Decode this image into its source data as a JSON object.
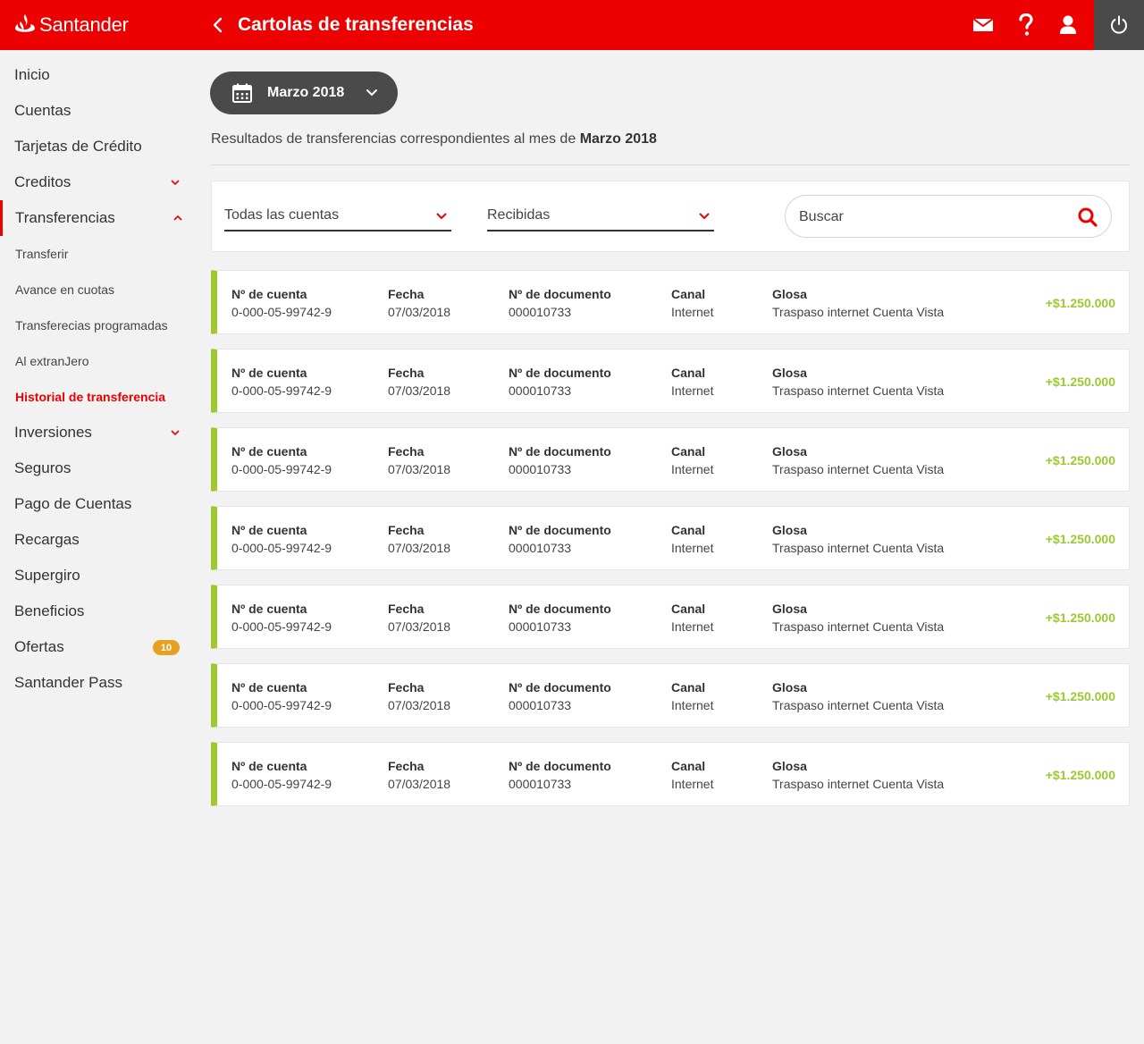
{
  "header": {
    "brand": "Santander",
    "title": "Cartolas de transferencias",
    "icons": [
      "back-arrow-icon",
      "mail-icon",
      "help-icon",
      "user-icon",
      "power-icon"
    ],
    "colors": {
      "brand_red": "#ec0000",
      "dark": "#4a4a4a",
      "positive": "#9bc92e",
      "badge": "#e8a020"
    }
  },
  "sidebar": {
    "items": [
      {
        "label": "Inicio"
      },
      {
        "label": "Cuentas"
      },
      {
        "label": "Tarjetas de Crédito"
      },
      {
        "label": "Creditos",
        "expandable": true
      },
      {
        "label": "Transferencias",
        "expanded": true
      },
      {
        "label": "Transferir"
      },
      {
        "label": "Avance en cuotas"
      },
      {
        "label": "Transferecias programadas"
      },
      {
        "label": "Al extranJero"
      },
      {
        "label": "Historial de transferencia",
        "active": true
      },
      {
        "label": "Inversiones",
        "expandable": true
      },
      {
        "label": "Seguros"
      },
      {
        "label": "Pago de Cuentas"
      },
      {
        "label": "Recargas"
      },
      {
        "label": "Supergiro"
      },
      {
        "label": "Beneficios"
      },
      {
        "label": "Ofertas",
        "badge": "10"
      },
      {
        "label": "Santander Pass"
      }
    ]
  },
  "main": {
    "date_selector": "Marzo 2018",
    "result_prefix": "Resultados de transferencias correspondientes al mes de",
    "result_month": "Marzo 2018",
    "filters": {
      "account": "Todas las cuentas",
      "type": "Recibidas",
      "search_placeholder": "Buscar"
    },
    "column_headers": {
      "account": "Nº de cuenta",
      "date": "Fecha",
      "document": "Nº de documento",
      "channel": "Canal",
      "gloss": "Glosa"
    },
    "rows": [
      {
        "account": "0-000-05-99742-9",
        "date": "07/03/2018",
        "document": "000010733",
        "channel": "Internet",
        "gloss": "Traspaso internet Cuenta Vista",
        "amount": "+$1.250.000"
      },
      {
        "account": "0-000-05-99742-9",
        "date": "07/03/2018",
        "document": "000010733",
        "channel": "Internet",
        "gloss": "Traspaso internet Cuenta Vista",
        "amount": "+$1.250.000"
      },
      {
        "account": "0-000-05-99742-9",
        "date": "07/03/2018",
        "document": "000010733",
        "channel": "Internet",
        "gloss": "Traspaso internet Cuenta Vista",
        "amount": "+$1.250.000"
      },
      {
        "account": "0-000-05-99742-9",
        "date": "07/03/2018",
        "document": "000010733",
        "channel": "Internet",
        "gloss": "Traspaso internet Cuenta Vista",
        "amount": "+$1.250.000"
      },
      {
        "account": "0-000-05-99742-9",
        "date": "07/03/2018",
        "document": "000010733",
        "channel": "Internet",
        "gloss": "Traspaso internet Cuenta Vista",
        "amount": "+$1.250.000"
      },
      {
        "account": "0-000-05-99742-9",
        "date": "07/03/2018",
        "document": "000010733",
        "channel": "Internet",
        "gloss": "Traspaso internet Cuenta Vista",
        "amount": "+$1.250.000"
      },
      {
        "account": "0-000-05-99742-9",
        "date": "07/03/2018",
        "document": "000010733",
        "channel": "Internet",
        "gloss": "Traspaso internet Cuenta Vista",
        "amount": "+$1.250.000"
      }
    ]
  }
}
